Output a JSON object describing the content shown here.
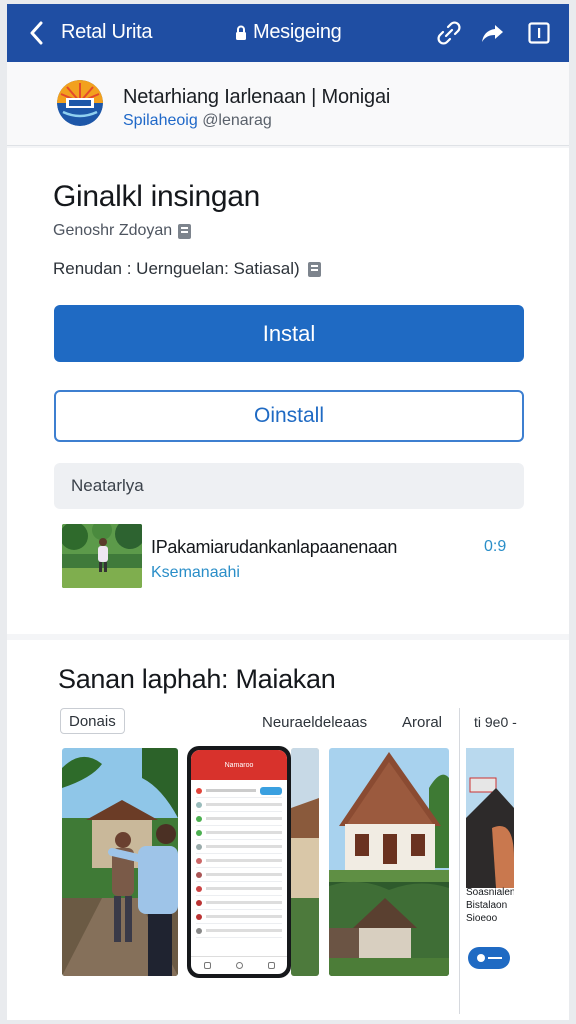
{
  "topbar": {
    "title": "Retal Urita",
    "center_label": "Mesigeing",
    "icons": [
      "back-icon",
      "lock-icon",
      "link-icon",
      "share-icon",
      "menu-icon"
    ]
  },
  "header": {
    "title": "Netarhiang Iarlenaan | Monigai",
    "sub_link": "Spilaheoig",
    "sub_handle": "@lenarag"
  },
  "app": {
    "title": "Ginalkl insingan",
    "meta_line": "Genoshr Zdoyan",
    "details_line": "Renudan : Uernguelan: Satiasal)",
    "install_label": "Instal",
    "uninstall_label": "Oinstall",
    "search_placeholder": "Neatarlya"
  },
  "update": {
    "title": "IPakamiarudankanlapaanenaan",
    "subtitle": "Ksemanaahi",
    "count": "0:9"
  },
  "screenshots": {
    "title": "Sanan laphah: Maiakan",
    "chip_label": "Donais",
    "filter_a": "Neuraeldeleaas",
    "filter_b": "Aroral",
    "filter_c": "ti 9e0 -",
    "phone_header": "Namaroo",
    "side_text": "Soasnialen Bistalaon Sioeoo",
    "colors": {
      "accent": "#1f6ac3",
      "topbar": "#1f4ea3",
      "phone_bar": "#d8322c"
    }
  }
}
